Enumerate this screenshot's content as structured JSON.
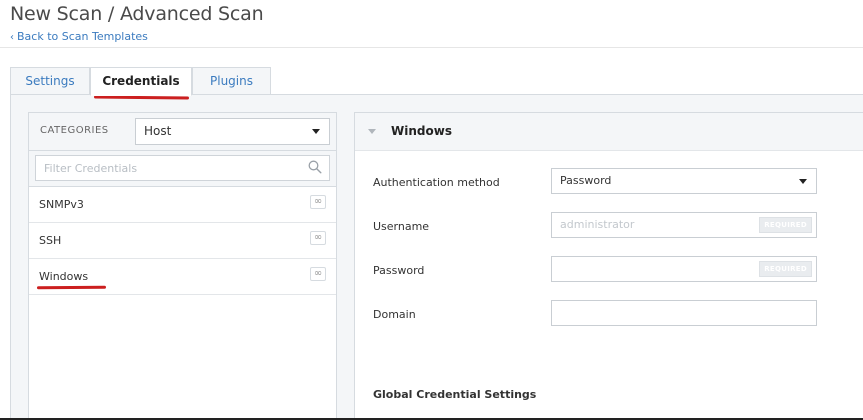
{
  "header": {
    "title": "New Scan / Advanced Scan",
    "back_link": "Back to Scan Templates"
  },
  "tabs": [
    {
      "label": "Settings",
      "active": false
    },
    {
      "label": "Credentials",
      "active": true
    },
    {
      "label": "Plugins",
      "active": false
    }
  ],
  "left": {
    "categories_label": "CATEGORIES",
    "category_selected": "Host",
    "filter_placeholder": "Filter Credentials",
    "items": [
      {
        "label": "SNMPv3",
        "badge": "∞"
      },
      {
        "label": "SSH",
        "badge": "∞"
      },
      {
        "label": "Windows",
        "badge": "∞"
      }
    ]
  },
  "right": {
    "section_title": "Windows",
    "fields": {
      "auth_label": "Authentication method",
      "auth_value": "Password",
      "username_label": "Username",
      "username_placeholder": "administrator",
      "password_label": "Password",
      "domain_label": "Domain",
      "required_badge": "REQUIRED"
    },
    "global_title": "Global Credential Settings"
  },
  "colors": {
    "link": "#3b7bbf",
    "annotation": "#cc1f1f",
    "panel_bg": "#f4f6f8",
    "border": "#d6dbe0"
  }
}
